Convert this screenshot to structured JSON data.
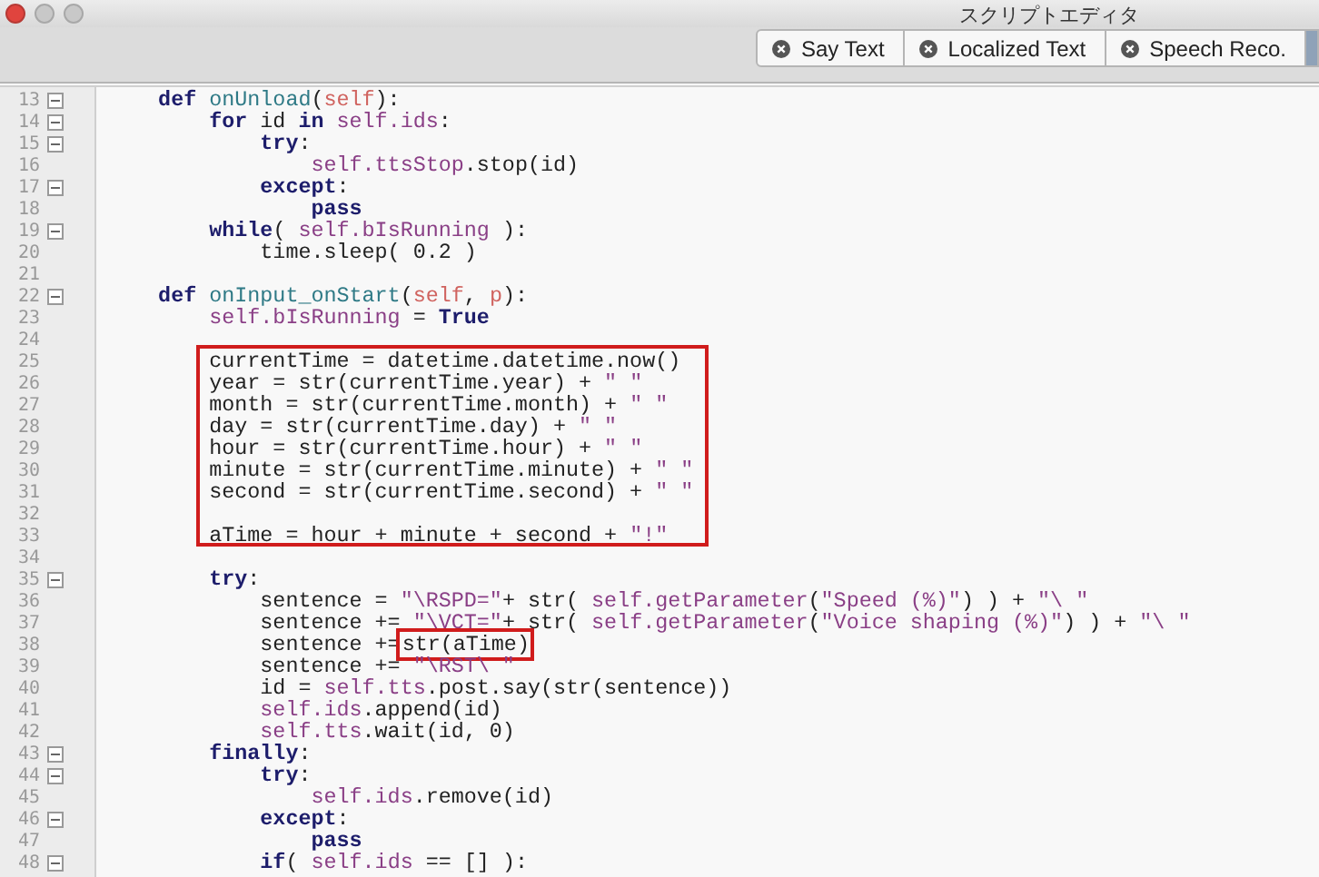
{
  "window": {
    "title": "スクリプトエディタ"
  },
  "tabs": [
    {
      "label": "Say Text",
      "selected": false
    },
    {
      "label": "Localized Text",
      "selected": false
    },
    {
      "label": "Speech Reco.",
      "selected": false
    },
    {
      "selected": true
    }
  ],
  "editor": {
    "blocks": [
      {
        "boxed": false,
        "lines": [
          {
            "number": "13",
            "fold": true,
            "segments": [
              {
                "kind": "keyword",
                "text": "    def "
              },
              {
                "kind": "function",
                "text": "onUnload"
              },
              {
                "kind": "text",
                "text": "("
              },
              {
                "kind": "param",
                "text": "self"
              },
              {
                "kind": "text",
                "text": "):"
              }
            ]
          },
          {
            "number": "14",
            "fold": true,
            "segments": [
              {
                "kind": "keyword",
                "text": "        for "
              },
              {
                "kind": "text",
                "text": "id "
              },
              {
                "kind": "keyword",
                "text": "in "
              },
              {
                "kind": "attribute",
                "text": "self.ids"
              },
              {
                "kind": "text",
                "text": ":"
              }
            ]
          },
          {
            "number": "15",
            "fold": true,
            "segments": [
              {
                "kind": "keyword",
                "text": "            try"
              },
              {
                "kind": "text",
                "text": ":"
              }
            ]
          },
          {
            "number": "16",
            "fold": false,
            "segments": [
              {
                "kind": "attribute",
                "text": "                self.ttsStop"
              },
              {
                "kind": "text",
                "text": ".stop(id)"
              }
            ]
          },
          {
            "number": "17",
            "fold": true,
            "segments": [
              {
                "kind": "keyword",
                "text": "            except"
              },
              {
                "kind": "text",
                "text": ":"
              }
            ]
          },
          {
            "number": "18",
            "fold": false,
            "segments": [
              {
                "kind": "keyword",
                "text": "                pass"
              }
            ]
          },
          {
            "number": "19",
            "fold": true,
            "segments": [
              {
                "kind": "keyword",
                "text": "        while"
              },
              {
                "kind": "text",
                "text": "( "
              },
              {
                "kind": "attribute",
                "text": "self.bIsRunning"
              },
              {
                "kind": "text",
                "text": " ):"
              }
            ]
          },
          {
            "number": "20",
            "fold": false,
            "segments": [
              {
                "kind": "text",
                "text": "            time.sleep( 0.2 )"
              }
            ]
          },
          {
            "number": "21",
            "fold": false
          },
          {
            "number": "22",
            "fold": true,
            "segments": [
              {
                "kind": "keyword",
                "text": "    def "
              },
              {
                "kind": "function",
                "text": "onInput_onStart"
              },
              {
                "kind": "text",
                "text": "("
              },
              {
                "kind": "param",
                "text": "self"
              },
              {
                "kind": "text",
                "text": ", "
              },
              {
                "kind": "param",
                "text": "p"
              },
              {
                "kind": "text",
                "text": "):"
              }
            ]
          },
          {
            "number": "23",
            "fold": false,
            "segments": [
              {
                "kind": "attribute",
                "text": "        self.bIsRunning"
              },
              {
                "kind": "text",
                "text": " = "
              },
              {
                "kind": "keyword",
                "text": "True"
              }
            ]
          },
          {
            "number": "24",
            "fold": false
          }
        ]
      },
      {
        "boxed": true,
        "lines": [
          {
            "number": "25",
            "fold": false,
            "segments": [
              {
                "kind": "text",
                "text": "        currentTime = datetime.datetime.now()"
              }
            ]
          },
          {
            "number": "26",
            "fold": false,
            "segments": [
              {
                "kind": "text",
                "text": "        year = str(currentTime.year) + "
              },
              {
                "kind": "string",
                "text": "\" \""
              }
            ]
          },
          {
            "number": "27",
            "fold": false,
            "segments": [
              {
                "kind": "text",
                "text": "        month = str(currentTime.month) + "
              },
              {
                "kind": "string",
                "text": "\" \""
              }
            ]
          },
          {
            "number": "28",
            "fold": false,
            "segments": [
              {
                "kind": "text",
                "text": "        day = str(currentTime.day) + "
              },
              {
                "kind": "string",
                "text": "\" \""
              }
            ]
          },
          {
            "number": "29",
            "fold": false,
            "segments": [
              {
                "kind": "text",
                "text": "        hour = str(currentTime.hour) + "
              },
              {
                "kind": "string",
                "text": "\" \""
              }
            ]
          },
          {
            "number": "30",
            "fold": false,
            "segments": [
              {
                "kind": "text",
                "text": "        minute = str(currentTime.minute) + "
              },
              {
                "kind": "string",
                "text": "\" \""
              }
            ]
          },
          {
            "number": "31",
            "fold": false,
            "segments": [
              {
                "kind": "text",
                "text": "        second = str(currentTime.second) + "
              },
              {
                "kind": "string",
                "text": "\" \""
              }
            ]
          },
          {
            "number": "32",
            "fold": false
          },
          {
            "number": "33",
            "fold": false,
            "segments": [
              {
                "kind": "text",
                "text": "        aTime = hour + minute + second + "
              },
              {
                "kind": "string",
                "text": "\"!\""
              }
            ]
          }
        ]
      },
      {
        "boxed": false,
        "lines": [
          {
            "number": "34",
            "fold": false
          },
          {
            "number": "35",
            "fold": true,
            "segments": [
              {
                "kind": "keyword",
                "text": "        try"
              },
              {
                "kind": "text",
                "text": ":"
              }
            ]
          },
          {
            "number": "36",
            "fold": false,
            "segments": [
              {
                "kind": "text",
                "text": "            sentence = "
              },
              {
                "kind": "string",
                "text": "\"\\RSPD=\""
              },
              {
                "kind": "text",
                "text": "+ str( "
              },
              {
                "kind": "attribute",
                "text": "self.getParameter"
              },
              {
                "kind": "text",
                "text": "("
              },
              {
                "kind": "string",
                "text": "\"Speed (%)\""
              },
              {
                "kind": "text",
                "text": ") ) + "
              },
              {
                "kind": "string",
                "text": "\"\\ \""
              }
            ]
          },
          {
            "number": "37",
            "fold": false,
            "segments": [
              {
                "kind": "text",
                "text": "            sentence += "
              },
              {
                "kind": "string",
                "text": "\"\\VCT=\""
              },
              {
                "kind": "text",
                "text": "+ str( "
              },
              {
                "kind": "attribute",
                "text": "self.getParameter"
              },
              {
                "kind": "text",
                "text": "("
              },
              {
                "kind": "string",
                "text": "\"Voice shaping (%)\""
              },
              {
                "kind": "text",
                "text": ") ) + "
              },
              {
                "kind": "string",
                "text": "\"\\ \""
              }
            ]
          },
          {
            "number": "38",
            "fold": false,
            "segments": [
              {
                "kind": "text",
                "text": "            sentence +="
              },
              {
                "kind": "marked",
                "text": "str(aTime)"
              }
            ]
          },
          {
            "number": "39",
            "fold": false,
            "segments": [
              {
                "kind": "text",
                "text": "            sentence += "
              },
              {
                "kind": "string",
                "text": "\"\\RST\\ \""
              }
            ]
          },
          {
            "number": "40",
            "fold": false,
            "segments": [
              {
                "kind": "text",
                "text": "            id = "
              },
              {
                "kind": "attribute",
                "text": "self.tts"
              },
              {
                "kind": "text",
                "text": ".post.say(str(sentence))"
              }
            ]
          },
          {
            "number": "41",
            "fold": false,
            "segments": [
              {
                "kind": "attribute",
                "text": "            self.ids"
              },
              {
                "kind": "text",
                "text": ".append(id)"
              }
            ]
          },
          {
            "number": "42",
            "fold": false,
            "segments": [
              {
                "kind": "attribute",
                "text": "            self.tts"
              },
              {
                "kind": "text",
                "text": ".wait(id, 0)"
              }
            ]
          },
          {
            "number": "43",
            "fold": true,
            "segments": [
              {
                "kind": "keyword",
                "text": "        finally"
              },
              {
                "kind": "text",
                "text": ":"
              }
            ]
          },
          {
            "number": "44",
            "fold": true,
            "segments": [
              {
                "kind": "keyword",
                "text": "            try"
              },
              {
                "kind": "text",
                "text": ":"
              }
            ]
          },
          {
            "number": "45",
            "fold": false,
            "segments": [
              {
                "kind": "attribute",
                "text": "                self.ids"
              },
              {
                "kind": "text",
                "text": ".remove(id)"
              }
            ]
          },
          {
            "number": "46",
            "fold": true,
            "segments": [
              {
                "kind": "keyword",
                "text": "            except"
              },
              {
                "kind": "text",
                "text": ":"
              }
            ]
          },
          {
            "number": "47",
            "fold": false,
            "segments": [
              {
                "kind": "keyword",
                "text": "                pass"
              }
            ]
          },
          {
            "number": "48",
            "fold": true,
            "segments": [
              {
                "kind": "keyword",
                "text": "            if"
              },
              {
                "kind": "text",
                "text": "( "
              },
              {
                "kind": "attribute",
                "text": "self.ids"
              },
              {
                "kind": "text",
                "text": " == [] ):"
              }
            ]
          }
        ]
      }
    ]
  }
}
